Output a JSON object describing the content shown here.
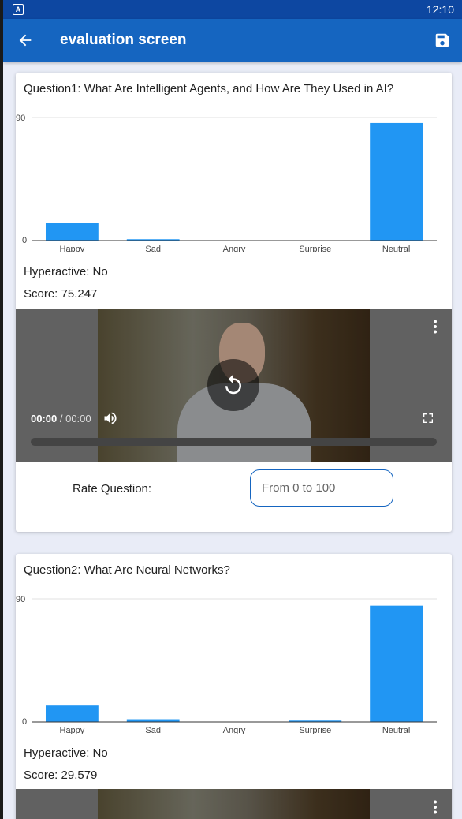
{
  "status_bar": {
    "time": "12:10",
    "notification_icon": "A"
  },
  "app_bar": {
    "title": "evaluation screen",
    "back_icon": "arrow-left-icon",
    "save_icon": "floppy-disk-icon"
  },
  "questions": [
    {
      "title": "Question1: What Are Intelligent Agents, and How Are They Used in AI?",
      "hyperactive": "Hyperactive: No",
      "score": "Score: 75.247",
      "video": {
        "current_time": "00:00",
        "separator": " / ",
        "duration": "00:00"
      },
      "rate_label": "Rate Question:",
      "rate_placeholder": "From 0 to 100",
      "chart": {
        "y_top_label": "90",
        "y_bottom_label": "0"
      }
    },
    {
      "title": "Question2: What Are Neural Networks?",
      "hyperactive": "Hyperactive: No",
      "score": "Score: 29.579",
      "chart": {
        "y_top_label": "90",
        "y_bottom_label": "0"
      }
    }
  ],
  "chart_data": [
    {
      "type": "bar",
      "categories": [
        "Happy",
        "Sad",
        "Angry",
        "Surprise",
        "Neutral"
      ],
      "values": [
        13,
        1,
        0,
        0,
        86
      ],
      "ylim": [
        0,
        90
      ],
      "color": "#2196f3",
      "grid": true
    },
    {
      "type": "bar",
      "categories": [
        "Happy",
        "Sad",
        "Angry",
        "Surprise",
        "Neutral"
      ],
      "values": [
        12,
        2,
        0,
        1,
        85
      ],
      "ylim": [
        0,
        90
      ],
      "color": "#2196f3",
      "grid": true
    }
  ]
}
